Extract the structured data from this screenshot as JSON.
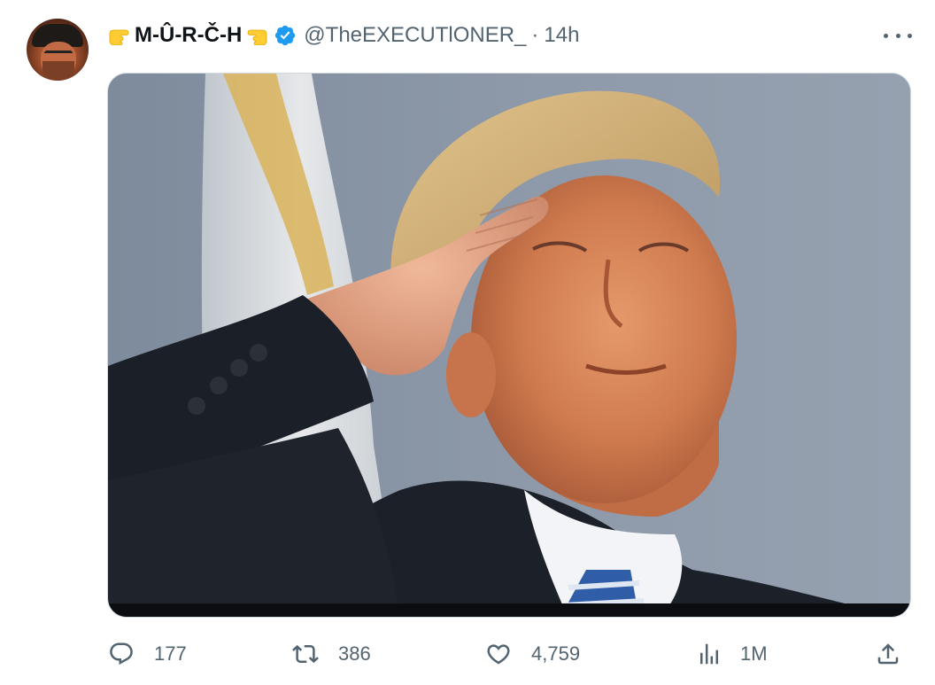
{
  "tweet": {
    "author": {
      "display_name": "M-Û-R-Č-H",
      "handle": "@TheEXECUTlONER_",
      "separator": "·",
      "time": "14h"
    },
    "actions": {
      "replies": "177",
      "retweets": "386",
      "likes": "4,759",
      "views": "1M"
    }
  },
  "icons": {
    "left_emoji": "backhand-index-pointing-right-icon",
    "right_emoji": "backhand-index-pointing-left-icon",
    "verified": "verified-badge-icon",
    "more": "more-options-icon",
    "reply": "reply-icon",
    "retweet": "retweet-icon",
    "like": "heart-icon",
    "views": "analytics-icon",
    "share": "share-icon"
  },
  "colors": {
    "verified_blue": "#1d9bf0",
    "secondary_text": "#536471",
    "primary_text": "#0f1419",
    "border": "#cfd9de"
  }
}
